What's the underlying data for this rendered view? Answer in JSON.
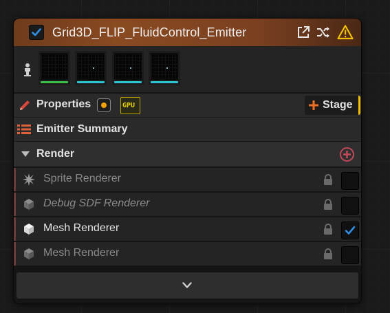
{
  "node": {
    "title": "Grid3D_FLIP_FluidControl_Emitter",
    "enabled": true,
    "header_icons": [
      "open-external-icon",
      "shuffle-icon",
      "warning-icon"
    ],
    "accent_color": "#8a4a21"
  },
  "thumbnails": [
    {
      "name": "thumbnail-1",
      "bar_color": "#3fbf4a"
    },
    {
      "name": "thumbnail-2",
      "bar_color": "#2fc3d8"
    },
    {
      "name": "thumbnail-3",
      "bar_color": "#2fc3d8"
    },
    {
      "name": "thumbnail-4",
      "bar_color": "#2fc3d8"
    }
  ],
  "properties": {
    "label": "Properties",
    "gpu_badge": "GPU",
    "stage_button": "Stage"
  },
  "emitter_summary": {
    "label": "Emitter Summary"
  },
  "render": {
    "label": "Render",
    "renderers": [
      {
        "label": "Sprite Renderer",
        "enabled": false,
        "italic": false,
        "icon": "sprite-icon"
      },
      {
        "label": "Debug SDF Renderer",
        "enabled": false,
        "italic": true,
        "icon": "cube-icon"
      },
      {
        "label": "Mesh Renderer",
        "enabled": true,
        "italic": false,
        "icon": "cube-icon"
      },
      {
        "label": "Mesh Renderer",
        "enabled": false,
        "italic": false,
        "icon": "cube-icon"
      }
    ]
  },
  "footer": {
    "icon": "chevron-down-icon"
  }
}
